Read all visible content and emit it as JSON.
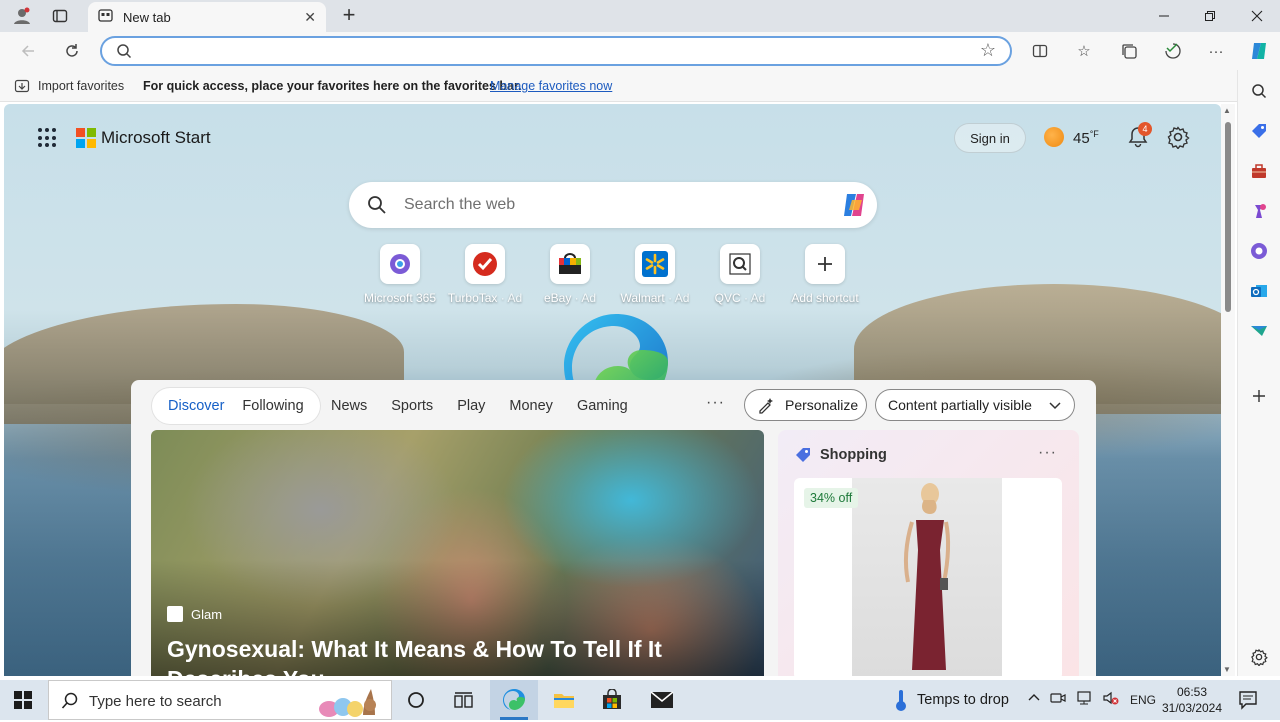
{
  "browser": {
    "tab_title": "New tab",
    "favorites_bar": {
      "import_label": "Import favorites",
      "message": "For quick access, place your favorites here on the favorites bar.",
      "manage_link": "Manage favorites now"
    },
    "address_value": ""
  },
  "ms_start": {
    "brand": "Microsoft Start",
    "sign_in": "Sign in",
    "temperature": "45",
    "temperature_unit": "°F",
    "notification_count": "4",
    "search_placeholder": "Search the web",
    "shortcuts": [
      {
        "label": "Microsoft 365",
        "ad": "",
        "icon": "microsoft-365-icon"
      },
      {
        "label": "TurboTax",
        "ad": "· Ad",
        "icon": "turbotax-icon"
      },
      {
        "label": "eBay",
        "ad": "· Ad",
        "icon": "ebay-icon"
      },
      {
        "label": "Walmart",
        "ad": "· Ad",
        "icon": "walmart-icon"
      },
      {
        "label": "QVC",
        "ad": "· Ad",
        "icon": "qvc-icon"
      },
      {
        "label": "Add shortcut",
        "ad": "",
        "icon": "plus-icon"
      }
    ]
  },
  "feed": {
    "tabs_primary": [
      "Discover",
      "Following"
    ],
    "tabs": [
      "News",
      "Sports",
      "Play",
      "Money",
      "Gaming"
    ],
    "more": "···",
    "personalize": "Personalize",
    "content_visibility": "Content partially visible",
    "hero": {
      "source": "Glam",
      "title": "Gynosexual: What It Means & How To Tell If It Describes You"
    },
    "shopping": {
      "title": "Shopping",
      "discount": "34% off"
    }
  },
  "taskbar": {
    "search_placeholder": "Type here to search",
    "weather": "Temps to drop",
    "language": "ENG",
    "time": "06:53",
    "date": "31/03/2024"
  },
  "colors": {
    "accent": "#1660c7",
    "omnibox_border": "#6aa1e0",
    "badge": "#e3562b"
  }
}
